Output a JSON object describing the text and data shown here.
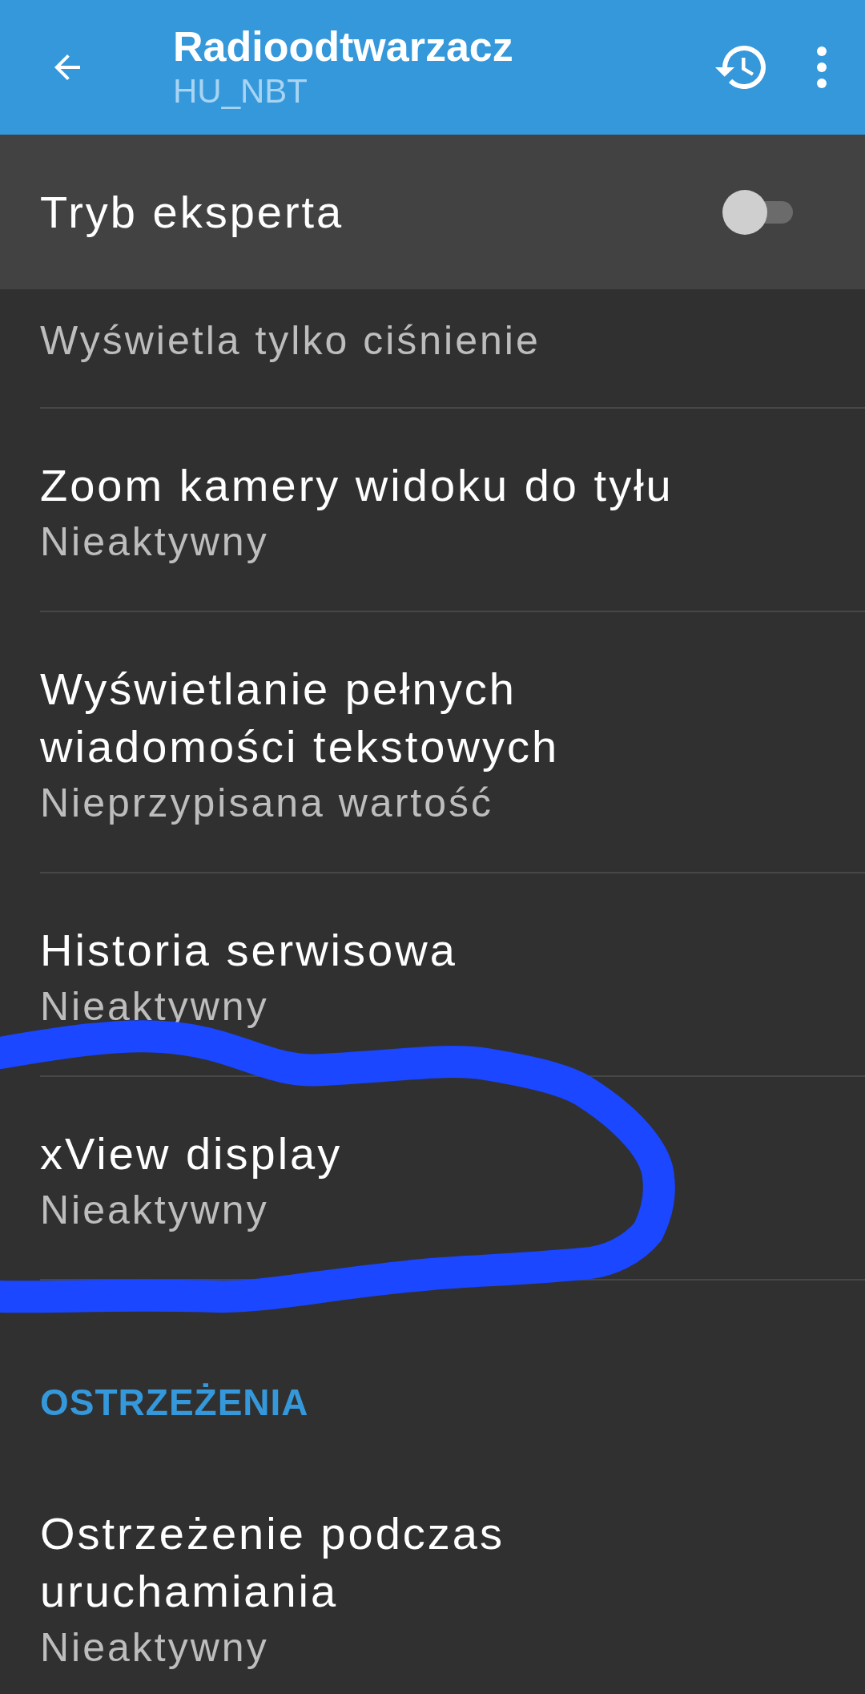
{
  "app_bar": {
    "title": "Radioodtwarzacz",
    "subtitle": "HU_NBT"
  },
  "expert_mode": {
    "label": "Tryb eksperta",
    "on": false
  },
  "items": [
    {
      "kind": "partial",
      "subtitle": "Wyświetla tylko ciśnienie"
    },
    {
      "kind": "setting",
      "title": "Zoom kamery widoku do tyłu",
      "subtitle": "Nieaktywny"
    },
    {
      "kind": "setting",
      "title": "Wyświetlanie pełnych wiadomości tekstowych",
      "subtitle": "Nieprzypisana wartość"
    },
    {
      "kind": "setting",
      "title": "Historia serwisowa",
      "subtitle": "Nieaktywny"
    },
    {
      "kind": "setting",
      "title": "xView display",
      "subtitle": "Nieaktywny"
    },
    {
      "kind": "section",
      "title": "OSTRZEŻENIA"
    },
    {
      "kind": "setting",
      "title": "Ostrzeżenie podczas uruchamiania",
      "subtitle": "Nieaktywny"
    }
  ]
}
